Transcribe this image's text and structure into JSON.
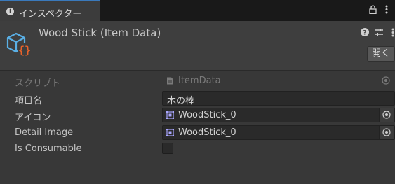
{
  "tab": {
    "title": "インスペクター",
    "icon": "info-icon"
  },
  "toolbar": {
    "lock_icon": "lock-icon",
    "menu_icon": "kebab-menu-icon"
  },
  "header": {
    "title": "Wood Stick (Item Data)",
    "icon": "scriptable-object-icon",
    "help_icon": "help-icon",
    "presets_icon": "presets-icon",
    "menu_icon": "kebab-menu-icon",
    "open_button": "開く"
  },
  "properties": [
    {
      "label": "スクリプト",
      "value": "ItemData",
      "type": "script",
      "disabled": true
    },
    {
      "label": "項目名",
      "value": "木の棒",
      "type": "text"
    },
    {
      "label": "アイコン",
      "value": "WoodStick_0",
      "type": "object"
    },
    {
      "label": "Detail Image",
      "value": "WoodStick_0",
      "type": "object"
    },
    {
      "label": "Is Consumable",
      "checked": false,
      "type": "bool"
    }
  ],
  "colors": {
    "background": "#383838",
    "tab_accent": "#3a79bb",
    "field_bg": "#2a2a2a",
    "icon_blue": "#5ab0e6",
    "icon_orange": "#e8622a"
  }
}
